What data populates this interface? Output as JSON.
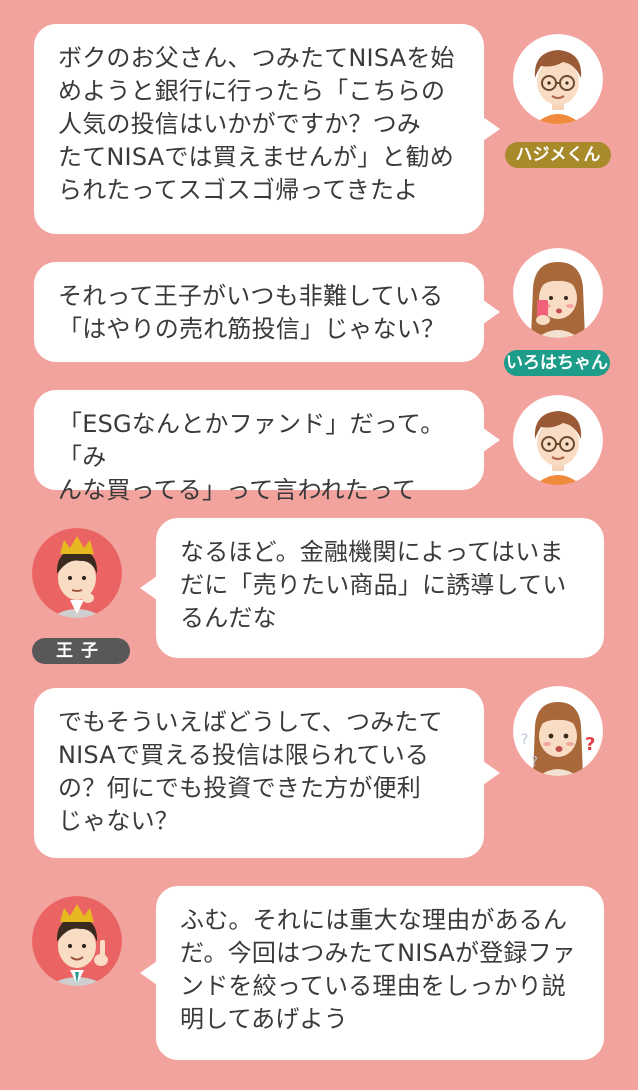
{
  "colors": {
    "background": "#f3a39d",
    "bubble": "#ffffff",
    "text": "#3a3a3a",
    "badge_hajime": "#a98a2b",
    "badge_iroha": "#1d9c8a",
    "badge_ouji": "#585858"
  },
  "characters": {
    "hajime": {
      "name": "ハジメくん",
      "avatar_icon": "boy-glasses-avatar-icon"
    },
    "iroha": {
      "name": "いろはちゃん",
      "avatar_icon": "girl-phone-avatar-icon"
    },
    "ouji": {
      "name": "王子",
      "avatar_icon": "prince-crown-avatar-icon"
    }
  },
  "messages": [
    {
      "speaker": "hajime",
      "text": "ボクのお父さん、つみたてNISAを始\nめようと銀行に行ったら「こちらの\n人気の投信はいかがですか？つみ\nたてNISAでは買えませんが」と勧め\nられたってスゴスゴ帰ってきたよ"
    },
    {
      "speaker": "iroha",
      "text": "それって王子がいつも非難している\n「はやりの売れ筋投信」じゃない？"
    },
    {
      "speaker": "hajime",
      "text": "「ESGなんとかファンド」だって。「み\nんな買ってる」って言われたって"
    },
    {
      "speaker": "ouji",
      "text": "なるほど。金融機関によってはいま\nだに「売りたい商品」に誘導してい\nるんだな"
    },
    {
      "speaker": "iroha",
      "text": "でもそういえばどうして、つみたて\nNISAで買える投信は限られている\nの？何にでも投資できた方が便利\nじゃない？"
    },
    {
      "speaker": "ouji",
      "text": "ふむ。それには重大な理由があるん\nだ。今回はつみたてNISAが登録ファ\nンドを絞っている理由をしっかり説\n明してあげよう"
    }
  ]
}
